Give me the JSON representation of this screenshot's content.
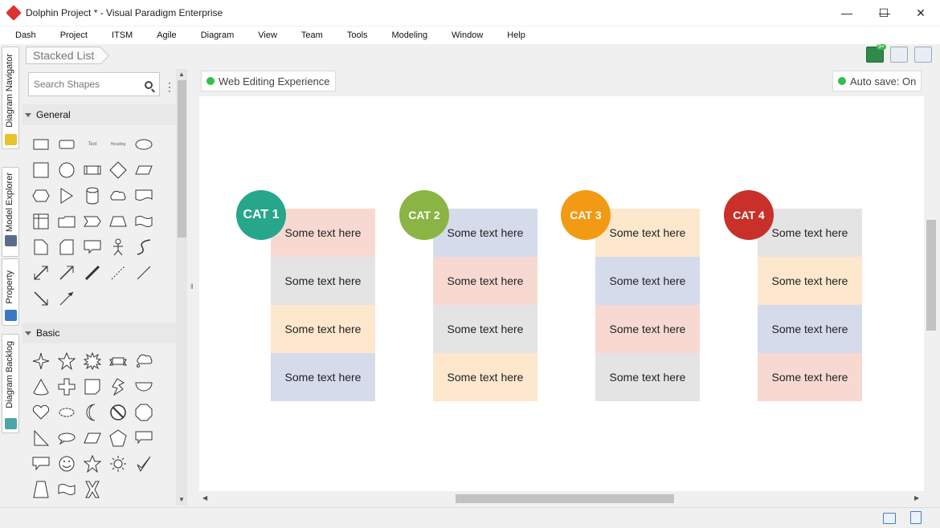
{
  "window": {
    "title": "Dolphin Project * - Visual Paradigm Enterprise",
    "minimize": "—",
    "maximize": "☐",
    "close": "✕"
  },
  "menu": [
    "Dash",
    "Project",
    "ITSM",
    "Agile",
    "Diagram",
    "View",
    "Team",
    "Tools",
    "Modeling",
    "Window",
    "Help"
  ],
  "left_tabs": [
    "Diagram Navigator",
    "Model Explorer",
    "Property",
    "Diagram Backlog"
  ],
  "breadcrumb": "Stacked List",
  "toolbar_icons": [
    "announcement-icon",
    "fit-diagram-icon",
    "panel-layout-icon"
  ],
  "notification_badge": "9+",
  "palette": {
    "search_placeholder": "Search Shapes",
    "sections": [
      {
        "name": "General"
      },
      {
        "name": "Basic"
      }
    ],
    "general_mini_labels": [
      "Text",
      "Heading"
    ]
  },
  "badges": {
    "web_editing": "Web Editing Experience",
    "auto_save": "Auto save: On",
    "status_color": "#2ec04a"
  },
  "diagram": {
    "categories": [
      {
        "label": "CAT 1",
        "color": "#26a68a",
        "items": [
          {
            "text": "Some text here",
            "color": "#f8d9d2"
          },
          {
            "text": "Some text here",
            "color": "#e4e4e4"
          },
          {
            "text": "Some text here",
            "color": "#fde7cd"
          },
          {
            "text": "Some text here",
            "color": "#d6dbec"
          }
        ]
      },
      {
        "label": "CAT 2",
        "color": "#8ab443",
        "items": [
          {
            "text": "Some text here",
            "color": "#d6dbec"
          },
          {
            "text": "Some text here",
            "color": "#f8d9d2"
          },
          {
            "text": "Some text here",
            "color": "#e4e4e4"
          },
          {
            "text": "Some text here",
            "color": "#fde7cd"
          }
        ]
      },
      {
        "label": "CAT 3",
        "color": "#f29a13",
        "items": [
          {
            "text": "Some text here",
            "color": "#fde7cd"
          },
          {
            "text": "Some text here",
            "color": "#d6dbec"
          },
          {
            "text": "Some text here",
            "color": "#f8d9d2"
          },
          {
            "text": "Some text here",
            "color": "#e4e4e4"
          }
        ]
      },
      {
        "label": "CAT 4",
        "color": "#c9302a",
        "items": [
          {
            "text": "Some text here",
            "color": "#e4e4e4"
          },
          {
            "text": "Some text here",
            "color": "#fde7cd"
          },
          {
            "text": "Some text here",
            "color": "#d6dbec"
          },
          {
            "text": "Some text here",
            "color": "#f8d9d2"
          }
        ]
      }
    ]
  }
}
